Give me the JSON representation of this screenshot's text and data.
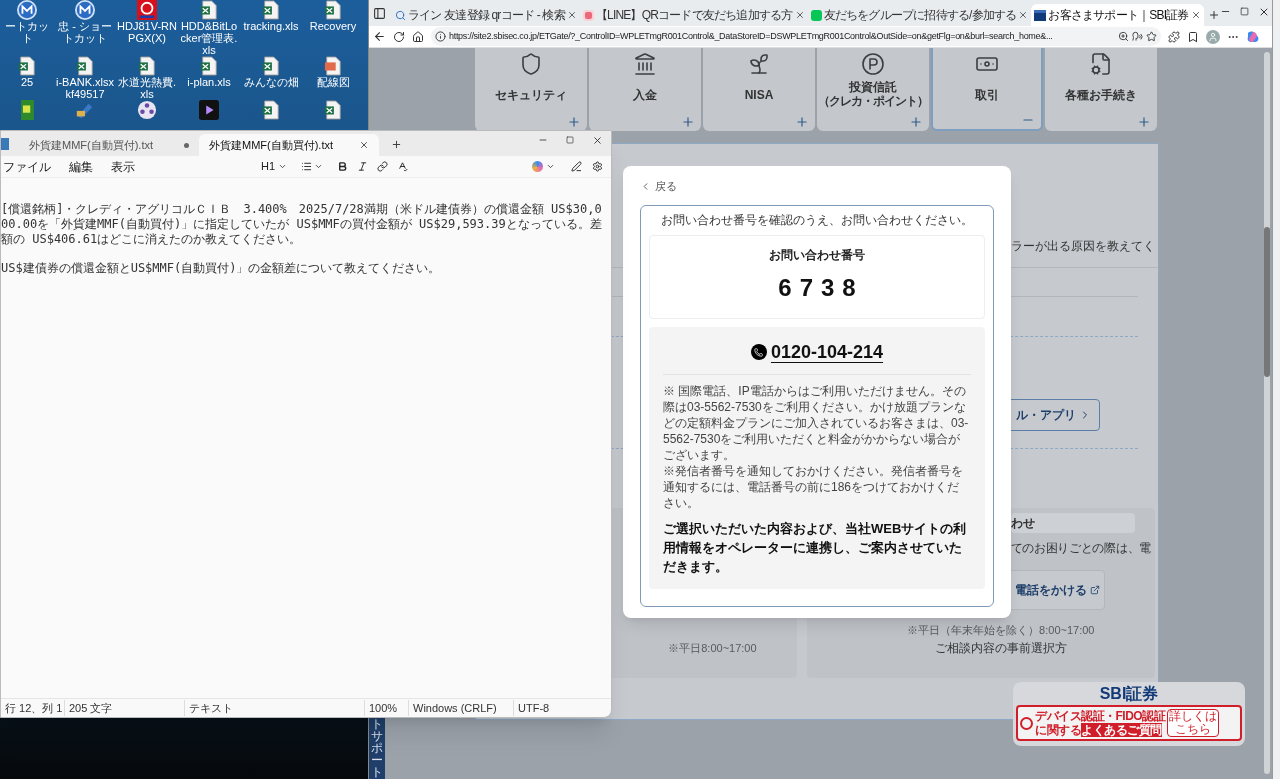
{
  "desktop": {
    "icons": [
      {
        "kind": "app-m",
        "label": "ートカット"
      },
      {
        "kind": "app-m",
        "label": "忠 - ショートカット"
      },
      {
        "kind": "red-logo",
        "label": "HDJ81V-RNPGX(X)"
      },
      {
        "kind": "sheet",
        "label": "HDD&BitLocker管理表.xls"
      },
      {
        "kind": "sheet",
        "label": "tracking.xls"
      },
      {
        "kind": "sheet",
        "label": "Recovery"
      },
      {
        "kind": "sheet",
        "label": "25"
      },
      {
        "kind": "sheet",
        "label": "i-BANK.xlsx kf49517"
      },
      {
        "kind": "sheet",
        "label": "水道光熱費.xls"
      },
      {
        "kind": "sheet",
        "label": "i-plan.xls"
      },
      {
        "kind": "sheet",
        "label": "みんなの畑"
      },
      {
        "kind": "image",
        "label": "配線図"
      },
      {
        "kind": "green-app"
      },
      {
        "kind": "tool"
      },
      {
        "kind": "reel"
      },
      {
        "kind": "player"
      },
      {
        "kind": "sheet"
      },
      {
        "kind": "sheet"
      }
    ]
  },
  "browser": {
    "tabs": [
      {
        "kind": "search",
        "label": "ライン 友達登録 qrコード - 検索",
        "selected": false
      },
      {
        "kind": "red",
        "label": "【LINE】QRコードで友だち追加する方",
        "selected": false
      },
      {
        "kind": "green",
        "label": "友だちをグループに招待する/参加する",
        "selected": false
      },
      {
        "kind": "site",
        "label": "お客さまサポート｜SBI証券",
        "selected": true
      }
    ],
    "url": "https://site2.sbisec.co.jp/ETGate/?_ControlID=WPLETmgR001Control&_DataStoreID=DSWPLETmgR001Control&OutSide=on&getFlg=on&burl=search_home&...",
    "page": {
      "categories": [
        {
          "kind": "shield",
          "label": "セキュリティ",
          "expanded": false
        },
        {
          "kind": "atm",
          "label": "入金",
          "expanded": false
        },
        {
          "kind": "sprout",
          "label": "NISA",
          "expanded": false
        },
        {
          "kind": "points",
          "label": "投資信託",
          "note": "（クレカ・ポイント）",
          "expanded": false
        },
        {
          "kind": "cash",
          "label": "取引",
          "expanded": true
        },
        {
          "kind": "doc",
          "label": "各種お手続き",
          "expanded": false
        }
      ],
      "faq_fragment": "ラーが出る原因を教えてく",
      "app_button": "ル・アプリ",
      "left_hours": "※平日8:00~17:00",
      "contact_card": {
        "heading": "わせ",
        "text": "てのお困りごとの際は、電",
        "call_button": "電話をかける",
        "hours": "※平日（年末年始を除く）8:00~17:00",
        "link": "ご相談内容の事前選択方"
      },
      "side_tab": "トサポート",
      "sbi_widget": {
        "logo": "SBI証券",
        "banner_line1": "デバイス認証・FIDO認証",
        "banner_prefix": "に関する",
        "banner_highlight": "よくあるご質問",
        "more": "詳しくはこちら"
      }
    },
    "dialog": {
      "back": "戻る",
      "prompt": "お問い合わせ番号を確認のうえ、お問い合わせください。",
      "number_label": "お問い合わせ番号",
      "number": "6738",
      "phone": "0120-104-214",
      "notes": [
        "※ 国際電話、IP電話からはご利用いただけません。その際は03-5562-7530をご利用ください。かけ放題プランなどの定額料金プランにご加入されているお客さまは、03-5562-7530をご利用いただくと料金がかからない場合がございます。",
        "※発信者番号を通知しておかけください。発信者番号を通知するには、電話番号の前に186をつけておかけください。"
      ],
      "info": "ご選択いただいた内容および、当社WEBサイトの利用情報をオペレーターに連携し、ご案内させていただきます。"
    }
  },
  "notepad": {
    "tabs": [
      {
        "label": "外貨建MMF(自動買付).txt",
        "selected": false,
        "unsaved": true
      },
      {
        "label": "外貨建MMF(自動買付).txt",
        "selected": true,
        "unsaved": false
      }
    ],
    "menu": [
      "ファイル",
      "編集",
      "表示"
    ],
    "heading_menu": "H1",
    "paragraphs": [
      "[償還銘柄]・クレディ・アグリコルＣＩＢ　3.400%　2025/7/28満期（米ドル建債券）の償還金額 US$30,000.00を「外貨建MMF(自動買付)」に指定していたが US$MMFの買付金額が US$29,593.39となっている。差額の US$406.61はどこに消えたのか教えてください。",
      "US$建債券の償還金額とUS$MMF(自動買付)」の金額差について教えてください。"
    ],
    "status": [
      "行 12、列 1",
      "205 文字",
      "テキスト",
      "100%",
      "Windows (CRLF)",
      "UTF-8"
    ]
  }
}
